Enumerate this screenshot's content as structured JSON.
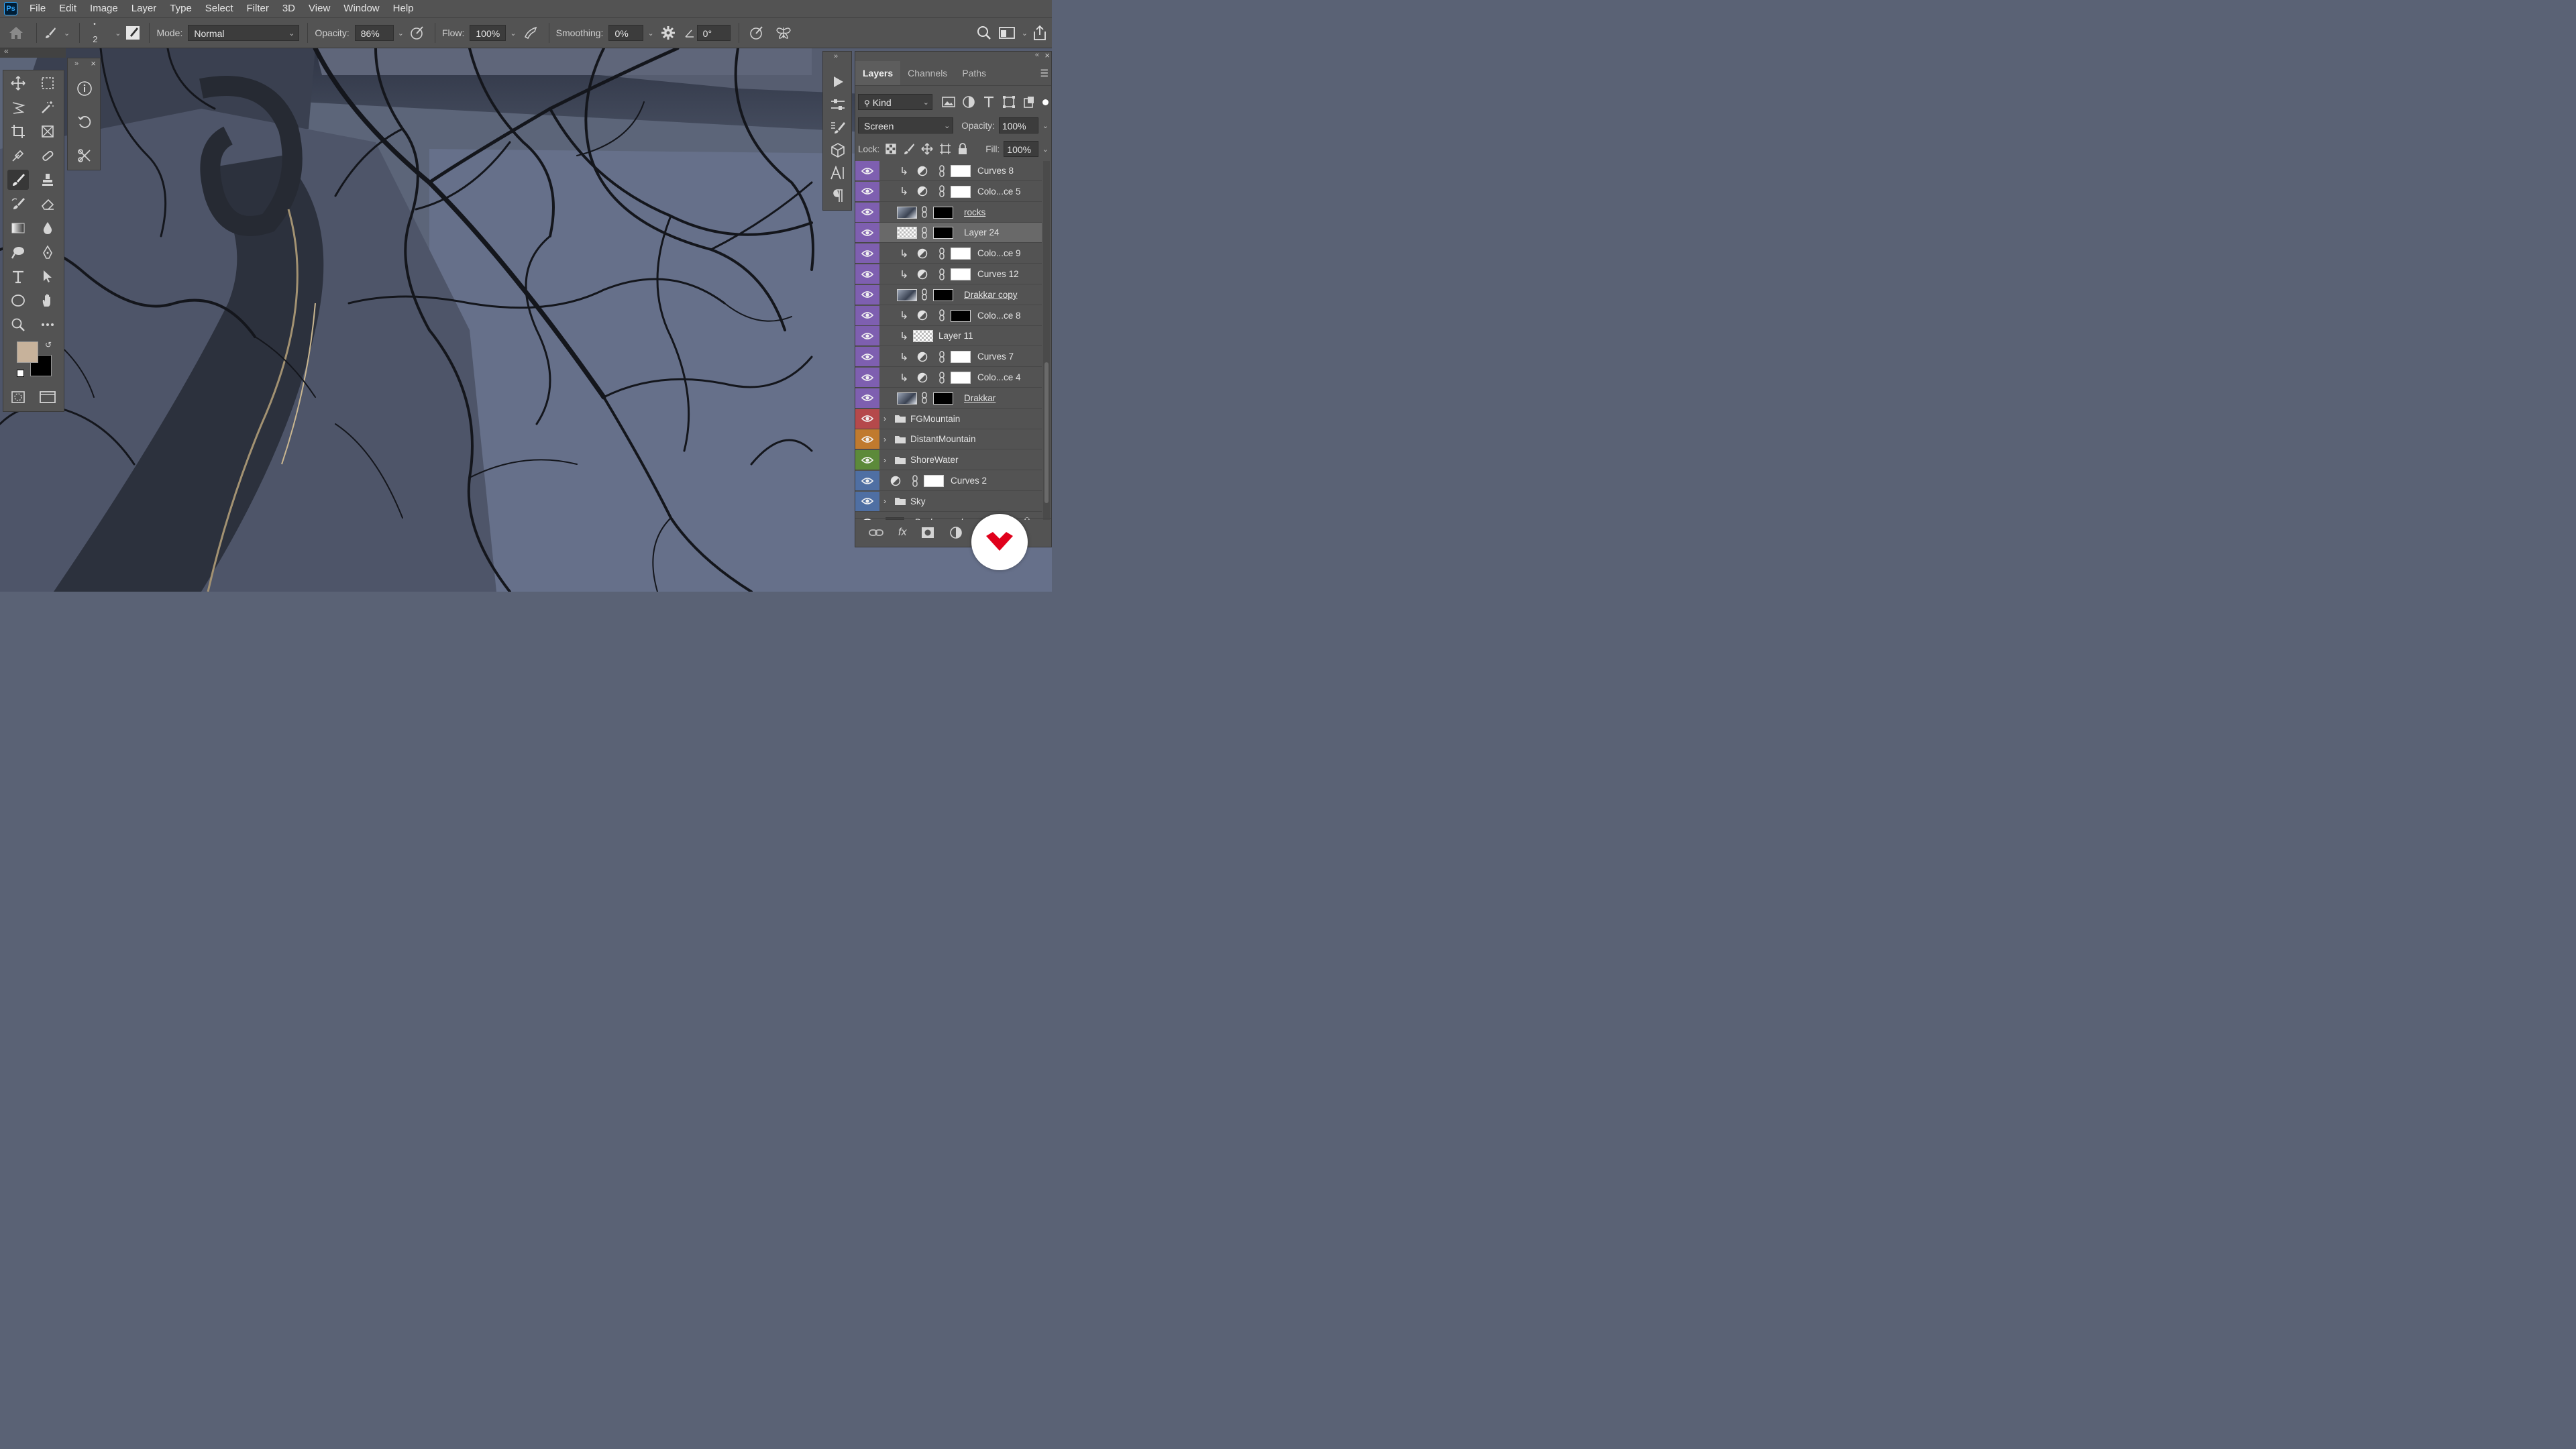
{
  "app": {
    "logo_text": "Ps"
  },
  "menu": [
    "File",
    "Edit",
    "Image",
    "Layer",
    "Type",
    "Select",
    "Filter",
    "3D",
    "View",
    "Window",
    "Help"
  ],
  "options_bar": {
    "brush_size": "2",
    "mode_label": "Mode:",
    "mode_value": "Normal",
    "opacity_label": "Opacity:",
    "opacity_value": "86%",
    "flow_label": "Flow:",
    "flow_value": "100%",
    "smoothing_label": "Smoothing:",
    "smoothing_value": "0%",
    "angle_value": "0°"
  },
  "colors": {
    "foreground": "#c7b29b",
    "background": "#000000",
    "accent": "#31a8ff"
  },
  "layers_panel": {
    "tabs": [
      "Layers",
      "Channels",
      "Paths"
    ],
    "active_tab": "Layers",
    "filter_value": "Kind",
    "blend_mode": "Screen",
    "opacity_label": "Opacity:",
    "opacity_value": "100%",
    "lock_label": "Lock:",
    "fill_label": "Fill:",
    "fill_value": "100%",
    "layers": [
      {
        "name": "Curves 8",
        "label_color": "#7e5fb0",
        "type": "adjustment",
        "clipped": true
      },
      {
        "name": "Colo...ce 5",
        "label_color": "#7e5fb0",
        "type": "adjustment",
        "clipped": true
      },
      {
        "name": "rocks",
        "label_color": "#7e5fb0",
        "type": "image-mask",
        "clipped": false
      },
      {
        "name": "Layer 24",
        "label_color": "#7e5fb0",
        "type": "checker-mask",
        "clipped": false,
        "selected": true
      },
      {
        "name": "Colo...ce 9",
        "label_color": "#7e5fb0",
        "type": "adjustment",
        "clipped": true
      },
      {
        "name": "Curves 12",
        "label_color": "#7e5fb0",
        "type": "adjustment",
        "clipped": true
      },
      {
        "name": "Drakkar copy",
        "label_color": "#7e5fb0",
        "type": "image-mask",
        "clipped": false
      },
      {
        "name": "Colo...ce 8",
        "label_color": "#7e5fb0",
        "type": "adjustment",
        "clipped": true
      },
      {
        "name": "Layer 11",
        "label_color": "#7e5fb0",
        "type": "checker",
        "clipped": true
      },
      {
        "name": "Curves 7",
        "label_color": "#7e5fb0",
        "type": "adjustment",
        "clipped": true
      },
      {
        "name": "Colo...ce 4",
        "label_color": "#7e5fb0",
        "type": "adjustment",
        "clipped": true
      },
      {
        "name": "Drakkar",
        "label_color": "#7e5fb0",
        "type": "image-mask",
        "clipped": false
      },
      {
        "name": "FGMountain",
        "label_color": "#b5494b",
        "type": "group",
        "clipped": false
      },
      {
        "name": "DistantMountain",
        "label_color": "#c07a2e",
        "type": "group",
        "clipped": false
      },
      {
        "name": "ShoreWater",
        "label_color": "#5c8a3a",
        "type": "group",
        "clipped": false
      },
      {
        "name": "Curves 2",
        "label_color": "#4f6fa3",
        "type": "adjustment-top",
        "clipped": false
      },
      {
        "name": "Sky",
        "label_color": "#4f6fa3",
        "type": "group",
        "clipped": false
      },
      {
        "name": "Background",
        "label_color": "#535353",
        "type": "background",
        "clipped": false
      }
    ]
  },
  "footer_icons": [
    "link-icon",
    "fx-icon",
    "mask-icon",
    "adjustment-icon",
    "folder-icon",
    "trash-icon"
  ]
}
